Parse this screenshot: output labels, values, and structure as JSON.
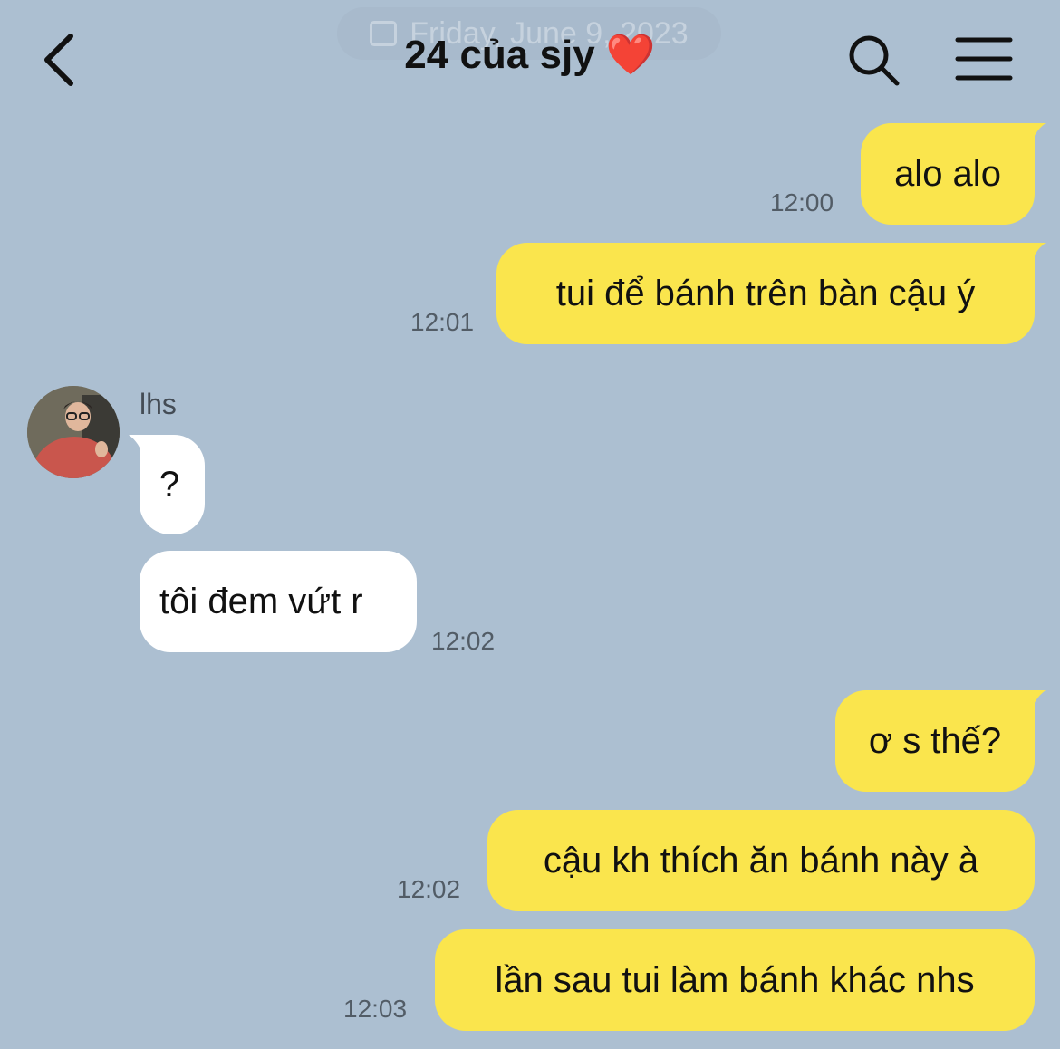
{
  "header": {
    "date_overlay": "Friday, June 9, 2023",
    "title": "24 của sjy",
    "title_emoji": "❤️",
    "back_icon": "chevron-left-icon",
    "search_icon": "search-icon",
    "menu_icon": "hamburger-menu-icon"
  },
  "colors": {
    "background": "#acbfd1",
    "my_bubble": "#fae54d",
    "their_bubble": "#ffffff"
  },
  "contact": {
    "name": "lhs"
  },
  "messages": [
    {
      "from": "me",
      "text": "alo alo",
      "time": "12:00"
    },
    {
      "from": "me",
      "text": "tui để bánh trên bàn cậu ý",
      "time": "12:01"
    },
    {
      "from": "them",
      "text": "?",
      "time": ""
    },
    {
      "from": "them",
      "text": "tôi đem vứt r",
      "time": "12:02"
    },
    {
      "from": "me",
      "text": "ơ s thế?",
      "time": ""
    },
    {
      "from": "me",
      "text": "cậu kh thích ăn bánh này à",
      "time": "12:02"
    },
    {
      "from": "me",
      "text": "lần sau tui làm bánh khác nhs",
      "time": "12:03"
    }
  ]
}
